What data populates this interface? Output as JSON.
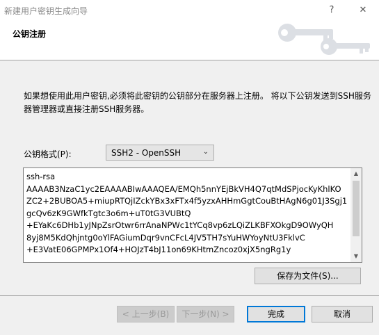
{
  "window": {
    "title": "新建用户密钥生成向导",
    "help_glyph": "?",
    "close_glyph": "✕"
  },
  "header": {
    "title": "公钥注册"
  },
  "description": "如果想使用此用户密钥,必须将此密钥的公钥部分在服务器上注册。 将以下公钥发送到SSH服务器管理器或直接注册SSH服务器。",
  "format": {
    "label": "公钥格式(P):",
    "selected": "SSH2 - OpenSSH"
  },
  "public_key": "ssh-rsa\nAAAAB3NzaC1yc2EAAAABIwAAAQEA/EMQh5nnYEjBkVH4Q7qtMdSPjocKyKhlKO\nZC2+2BUBOA5+miupRTQjIZckYBx3xFTx4f5yzxAHHmGgtCouBtHAgN6g01J3Sgj1\ngcQv6zK9GWfkTgtc3o6m+uT0tG3VUBtQ\n+EYaKc6DHb1yJNpZsrOtwr6rrAnaNPWc1tYCq8vp6zLQiZLKBFXOkgD9OWyQH\n8yj8M5KdQhjntg0oYlFAGiumDqr9vnCFcL4JV5TH7sYuHWYoyNtU3FklvC\n+E3VatE06GPMPx1Of4+HOJzT4bJ11on69KHtmZncoz0xjX5ngRg1y",
  "buttons": {
    "save": "保存为文件(S)...",
    "back": "< 上一步(B)",
    "next": "下一步(N) >",
    "finish": "完成",
    "cancel": "取消"
  }
}
